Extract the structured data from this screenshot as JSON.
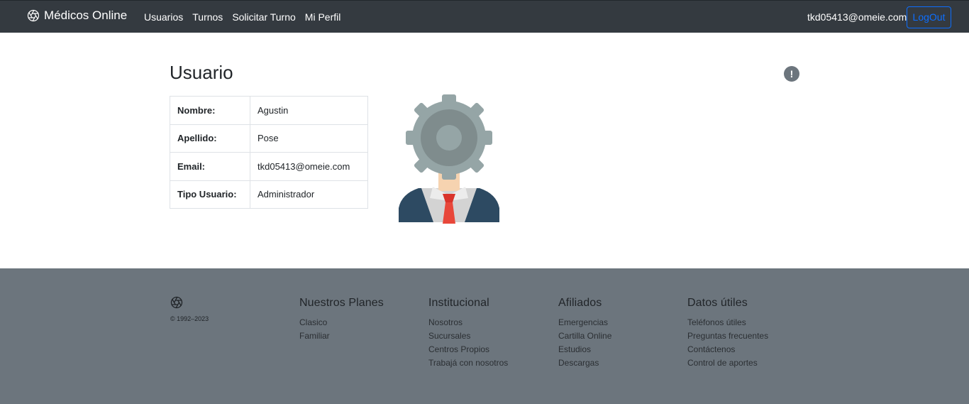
{
  "navbar": {
    "brand": "Médicos Online",
    "links": [
      "Usuarios",
      "Turnos",
      "Solicitar Turno",
      "Mi Perfil"
    ],
    "user_email": "tkd05413@omeie.com",
    "logout_label": "LogOut"
  },
  "main": {
    "title": "Usuario",
    "info_icon": "!",
    "rows": [
      {
        "label": "Nombre:",
        "value": "Agustin"
      },
      {
        "label": "Apellido:",
        "value": "Pose"
      },
      {
        "label": "Email:",
        "value": "tkd05413@omeie.com"
      },
      {
        "label": "Tipo Usuario:",
        "value": "Administrador"
      }
    ]
  },
  "footer": {
    "copyright": "© 1992–2023",
    "columns": [
      {
        "title": "Nuestros Planes",
        "links": [
          "Clasico",
          "Familiar"
        ]
      },
      {
        "title": "Institucional",
        "links": [
          "Nosotros",
          "Sucursales",
          "Centros Propios",
          "Trabajá con nosotros"
        ]
      },
      {
        "title": "Afiliados",
        "links": [
          "Emergencias",
          "Cartilla Online",
          "Estudios",
          "Descargas"
        ]
      },
      {
        "title": "Datos útiles",
        "links": [
          "Teléfonos útiles",
          "Preguntas frecuentes",
          "Contáctenos",
          "Control de aportes"
        ]
      }
    ]
  },
  "colors": {
    "navbar_bg": "#343a40",
    "primary": "#0d6efd",
    "footer_bg": "#6c757d"
  },
  "icons": {
    "brand": "aperture-icon",
    "info": "exclamation-circle-icon",
    "avatar": "gear-head-businessman-icon"
  }
}
